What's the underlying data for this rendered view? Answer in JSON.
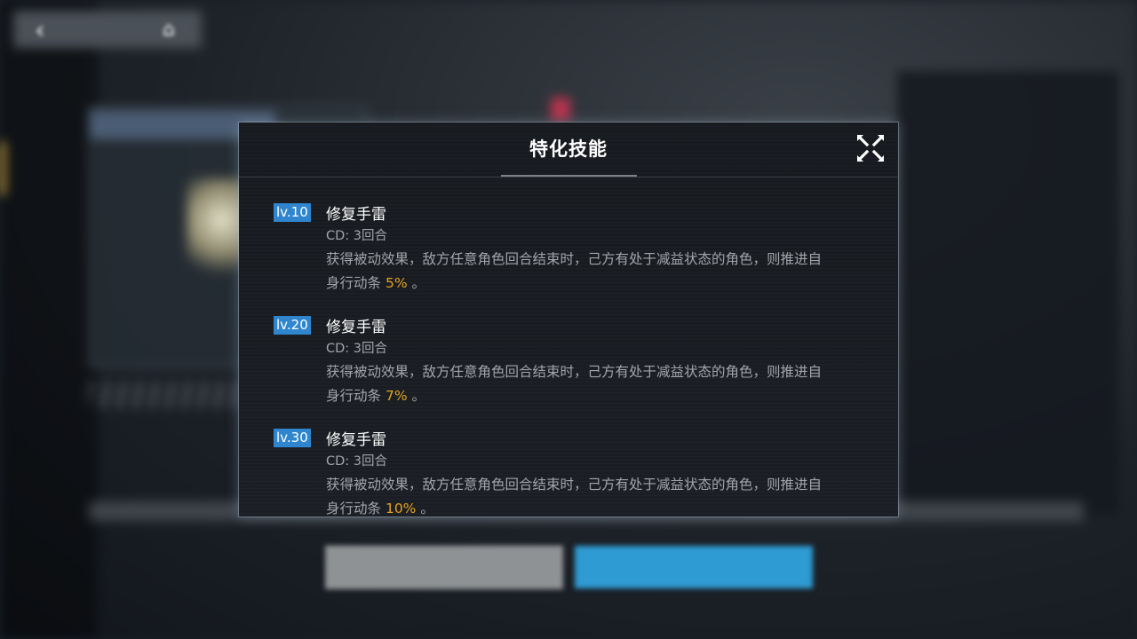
{
  "modal": {
    "title": "特化技能",
    "skills": [
      {
        "level": "lv.10",
        "name": "修复手雷",
        "cd": "CD: 3回合",
        "desc_line1": "获得被动效果，敌方任意角色回合结束时，己方有处于减益状态的角色，则推进自",
        "desc_line2_prefix": "身行动条",
        "percent": "5%",
        "desc_line2_suffix": "。"
      },
      {
        "level": "lv.20",
        "name": "修复手雷",
        "cd": "CD: 3回合",
        "desc_line1": "获得被动效果，敌方任意角色回合结束时，己方有处于减益状态的角色，则推进自",
        "desc_line2_prefix": "身行动条",
        "percent": "7%",
        "desc_line2_suffix": "。"
      },
      {
        "level": "lv.30",
        "name": "修复手雷",
        "cd": "CD: 3回合",
        "desc_line1": "获得被动效果，敌方任意角色回合结束时，己方有处于减益状态的角色，则推进自",
        "desc_line2_prefix": "身行动条",
        "percent": "10%",
        "desc_line2_suffix": "。"
      }
    ]
  },
  "colors": {
    "level_badge": "#2f86cf",
    "percent_highlight": "#e5a21e",
    "confirm_button": "#2f9bd3",
    "cancel_button": "#8f9294"
  },
  "icons": {
    "back": "chevron-left-icon",
    "home": "home-icon",
    "close": "close-x-icon"
  }
}
